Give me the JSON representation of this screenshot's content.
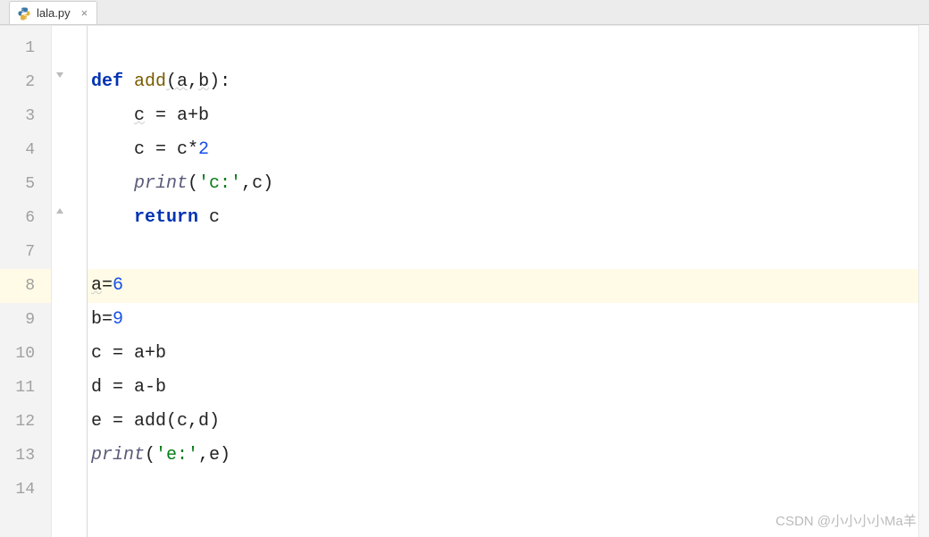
{
  "tab": {
    "filename": "lala.py",
    "close_glyph": "×"
  },
  "gutter": {
    "lines": [
      "1",
      "2",
      "3",
      "4",
      "5",
      "6",
      "7",
      "8",
      "9",
      "10",
      "11",
      "12",
      "13",
      "14"
    ],
    "highlighted_line": 8
  },
  "code": {
    "lines": [
      {
        "tokens": []
      },
      {
        "tokens": [
          {
            "t": "def ",
            "c": "kw"
          },
          {
            "t": "add",
            "c": "fn"
          },
          {
            "t": "(a",
            "c": "plain",
            "wavy": true
          },
          {
            "t": ",",
            "c": "plain"
          },
          {
            "t": "b",
            "c": "plain",
            "wavy": true
          },
          {
            "t": "):",
            "c": "plain"
          }
        ]
      },
      {
        "indent": "    ",
        "tokens": [
          {
            "t": "c",
            "c": "plain",
            "wavy": true
          },
          {
            "t": " = a+b",
            "c": "plain"
          }
        ]
      },
      {
        "indent": "    ",
        "tokens": [
          {
            "t": "c = c*",
            "c": "plain"
          },
          {
            "t": "2",
            "c": "num"
          }
        ]
      },
      {
        "indent": "    ",
        "tokens": [
          {
            "t": "print",
            "c": "builtin"
          },
          {
            "t": "(",
            "c": "plain"
          },
          {
            "t": "'c:'",
            "c": "str"
          },
          {
            "t": ",c)",
            "c": "plain"
          }
        ]
      },
      {
        "indent": "    ",
        "tokens": [
          {
            "t": "return ",
            "c": "kw"
          },
          {
            "t": "c",
            "c": "plain"
          }
        ]
      },
      {
        "tokens": []
      },
      {
        "tokens": [
          {
            "t": "a",
            "c": "plain",
            "wavy": true
          },
          {
            "t": "=",
            "c": "plain"
          },
          {
            "t": "6",
            "c": "num"
          }
        ],
        "hl": true
      },
      {
        "tokens": [
          {
            "t": "b=",
            "c": "plain"
          },
          {
            "t": "9",
            "c": "num"
          }
        ]
      },
      {
        "tokens": [
          {
            "t": "c = a+b",
            "c": "plain"
          }
        ]
      },
      {
        "tokens": [
          {
            "t": "d = a-b",
            "c": "plain"
          }
        ]
      },
      {
        "tokens": [
          {
            "t": "e = add(c",
            "c": "plain"
          },
          {
            "t": ",",
            "c": "plain"
          },
          {
            "t": "d)",
            "c": "plain"
          }
        ]
      },
      {
        "tokens": [
          {
            "t": "print",
            "c": "builtin"
          },
          {
            "t": "(",
            "c": "plain"
          },
          {
            "t": "'e:'",
            "c": "str"
          },
          {
            "t": ",e)",
            "c": "plain"
          }
        ]
      },
      {
        "tokens": []
      }
    ]
  },
  "watermark": "CSDN @小小小小Ma羊"
}
